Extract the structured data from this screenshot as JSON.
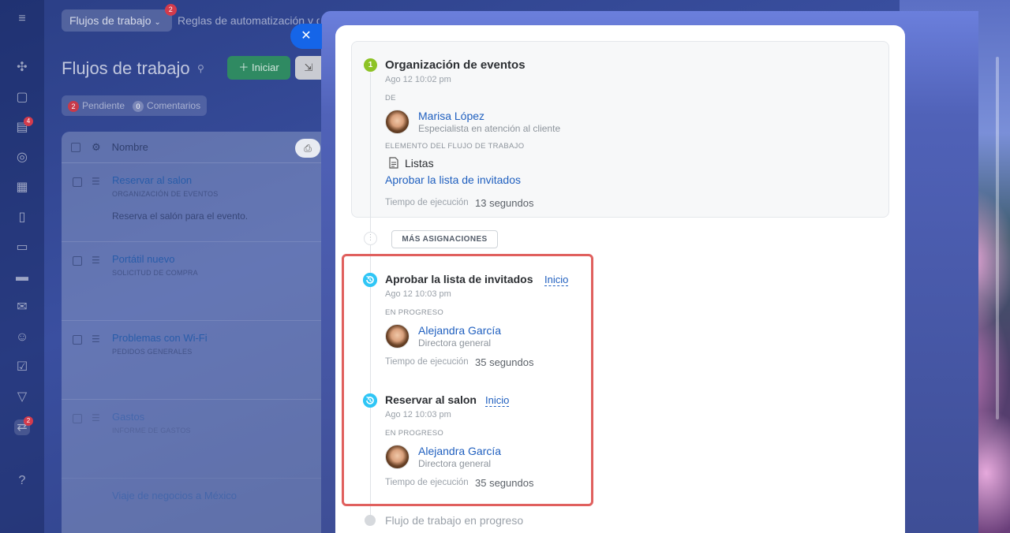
{
  "topbar": {
    "tab_label": "Flujos de trabajo",
    "tab_badge": "2",
    "rules_link": "Reglas de automatización y d"
  },
  "left_rail": {
    "badges": [
      "4",
      "2"
    ]
  },
  "page": {
    "title": "Flujos de trabajo",
    "start_button": "Iniciar",
    "filters": [
      {
        "count": "2",
        "label": "Pendiente"
      },
      {
        "count": "0",
        "label": "Comentarios"
      }
    ]
  },
  "list": {
    "column_name": "Nombre",
    "rows": [
      {
        "title": "Reservar al salon",
        "subtitle": "ORGANIZACIÓN DE EVENTOS",
        "description": "Reserva el salón para el evento."
      },
      {
        "title": "Portátil nuevo",
        "subtitle": "SOLICITUD DE COMPRA",
        "description": ""
      },
      {
        "title": "Problemas con Wi-Fi",
        "subtitle": "PEDIDOS GENERALES",
        "description": ""
      },
      {
        "title": "Gastos",
        "subtitle": "INFORME DE GASTOS",
        "description": ""
      },
      {
        "title": "Viaje de negocios a México",
        "subtitle": "",
        "description": ""
      }
    ]
  },
  "detail": {
    "step1": {
      "number": "1",
      "title": "Organización de eventos",
      "date": "Ago 12 10:02 pm",
      "from_caption": "DE",
      "author_name": "Marisa López",
      "author_role": "Especialista en atención al cliente",
      "element_caption": "ELEMENTO DEL FLUJO DE TRABAJO",
      "element_type": "Listas",
      "element_link": "Aprobar la lista de invitados",
      "runtime_label": "Tiempo de ejecución",
      "runtime_value": "13 segundos"
    },
    "more_assignments": "MÁS ASIGNACIONES",
    "tasks": [
      {
        "title": "Aprobar la lista de invitados",
        "start_link": "Inicio",
        "date": "Ago 12 10:03 pm",
        "status": "EN PROGRESO",
        "assignee": "Alejandra García",
        "assignee_role": "Directora general",
        "runtime_label": "Tiempo de ejecución",
        "runtime_value": "35 segundos"
      },
      {
        "title": "Reservar al salon",
        "start_link": "Inicio",
        "date": "Ago 12 10:03 pm",
        "status": "EN PROGRESO",
        "assignee": "Alejandra García",
        "assignee_role": "Directora general",
        "runtime_label": "Tiempo de ejecución",
        "runtime_value": "35 segundos"
      }
    ],
    "footer_status": "Flujo de trabajo en progreso"
  },
  "colors": {
    "accent_blue": "#1565e8",
    "link": "#1f5fbf",
    "step_green": "#8dc325",
    "running_cyan": "#2fc6f6",
    "highlight_red": "#e0605e"
  }
}
